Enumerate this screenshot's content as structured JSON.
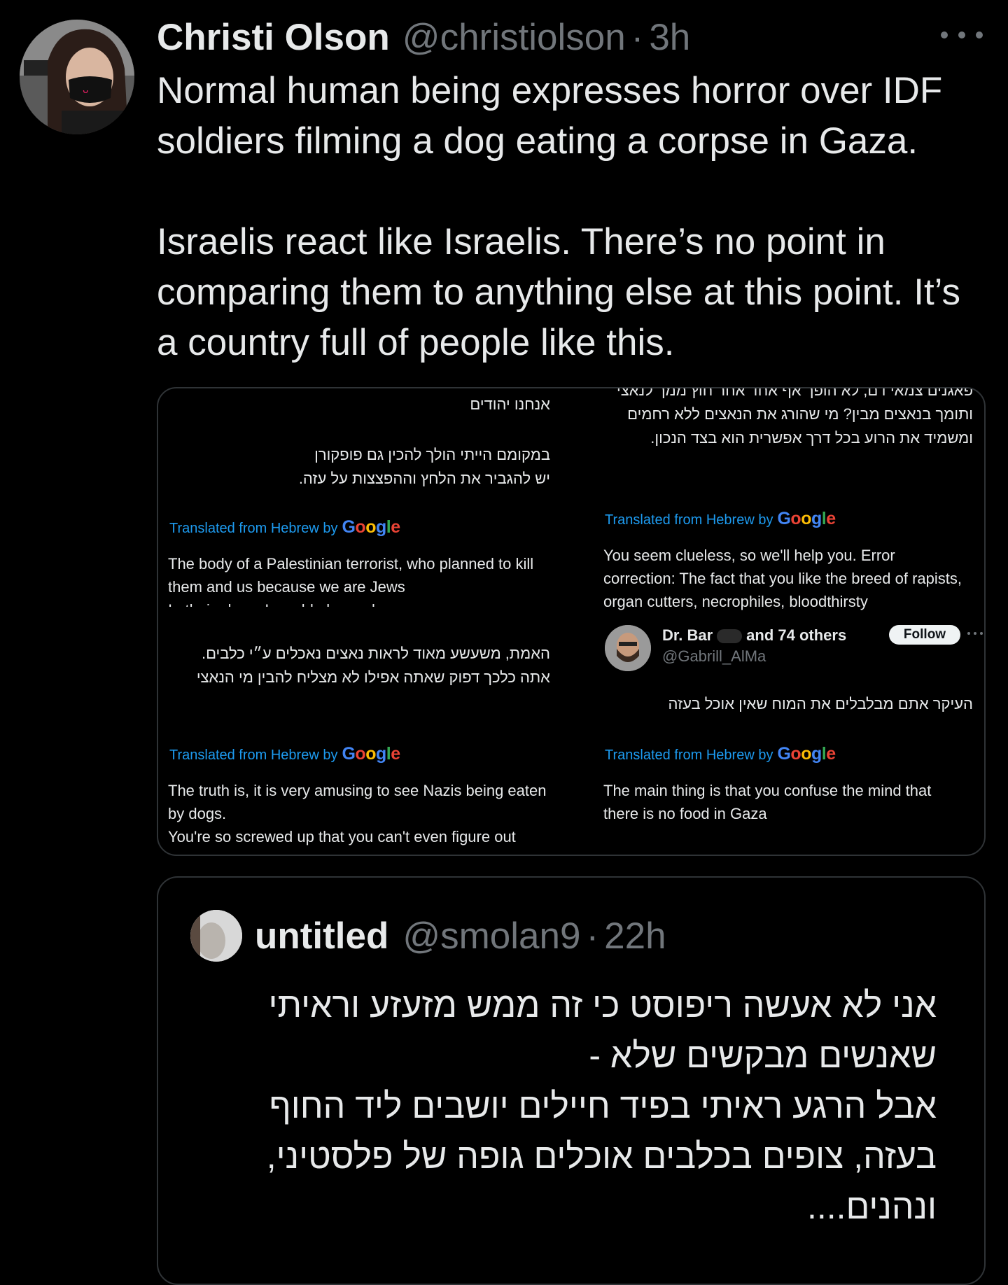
{
  "tweet": {
    "display_name": "Christi Olson",
    "handle": "@christiolson",
    "separator": "·",
    "time": "3h",
    "avatar_icon": "profile-photo-woman-with-face-mask",
    "more_icon": "ellipsis-horizontal-icon",
    "text_paragraphs": [
      "Normal human being expresses horror over IDF soldiers filming a dog eating a corpse in Gaza.",
      "Israelis react like Israelis. There’s no point in comparing them to anything else at this point. It’s a country full of people like this."
    ]
  },
  "media": {
    "left": {
      "hebrew_1": "אנחנו יהודים",
      "hebrew_2": "במקומם הייתי הולך להכין גם פופקורן\nיש להגביר את הלחץ וההפצצות על עזה.",
      "translated_label_1": "Translated from Hebrew by",
      "english_1": "The body of a Palestinian terrorist, who planned to kill them and us because we are Jews",
      "english_1_cut": "In their place, I would also make popcorn",
      "hebrew_3": "האמת, משעשע מאוד לראות נאצים נאכלים ע״י כלבים.\nאתה כלכך דפוק שאתה אפילו לא מצליח להבין מי הנאצי",
      "translated_label_2": "Translated from Hebrew by",
      "english_2": "The truth is, it is very amusing to see Nazis being eaten by dogs.\nYou're so screwed up that you can't even figure out"
    },
    "right": {
      "hebrew_1": "פאגנים צמאי דם, לא הופך אף אחד אחר חוץ ממך לנאצי ותומך בנאצים מבין? מי שהורג את הנאצים ללא רחמים ומשמיד את הרוע בכל דרך אפשרית הוא בצד הנכון.",
      "translated_label_1": "Translated from Hebrew by",
      "english_1": "You seem clueless, so we'll help you. Error correction: The fact that you like the breed of rapists, organ cutters, necrophiles, bloodthirsty",
      "user_name_a": "Dr. Bar",
      "user_name_b": "and 74 others",
      "user_handle": "@Gabrill_AlMa",
      "follow_label": "Follow",
      "hebrew_2": "העיקר אתם מבלבלים את המוח שאין אוכל בעזה",
      "translated_label_2": "Translated from Hebrew by",
      "english_2": "The main thing is that you confuse the mind that there is no food in Gaza"
    },
    "google_letters": [
      "G",
      "o",
      "o",
      "g",
      "l",
      "e"
    ],
    "google_colors": [
      "#4285f4",
      "#ea4335",
      "#fbbc05",
      "#4285f4",
      "#34a853",
      "#ea4335"
    ]
  },
  "quote": {
    "display_name": "untitled",
    "handle": "@smolan9",
    "separator": "·",
    "time": "22h",
    "avatar_icon": "profile-photo-blurred",
    "text_lines": [
      "אני לא אעשה ריפוסט כי זה ממש מזעזע וראיתי",
      "שאנשים מבקשים שלא -",
      "אבל הרגע ראיתי בפיד חיילים יושבים ליד החוף",
      "בעזה, צופים בכלבים אוכלים גופה של פלסטיני,",
      "ונהנים...."
    ]
  },
  "colors": {
    "background": "#000000",
    "text_primary": "#e7e9ea",
    "text_secondary": "#71767b",
    "border": "#2f3336",
    "link_blue": "#1d9bf0"
  }
}
